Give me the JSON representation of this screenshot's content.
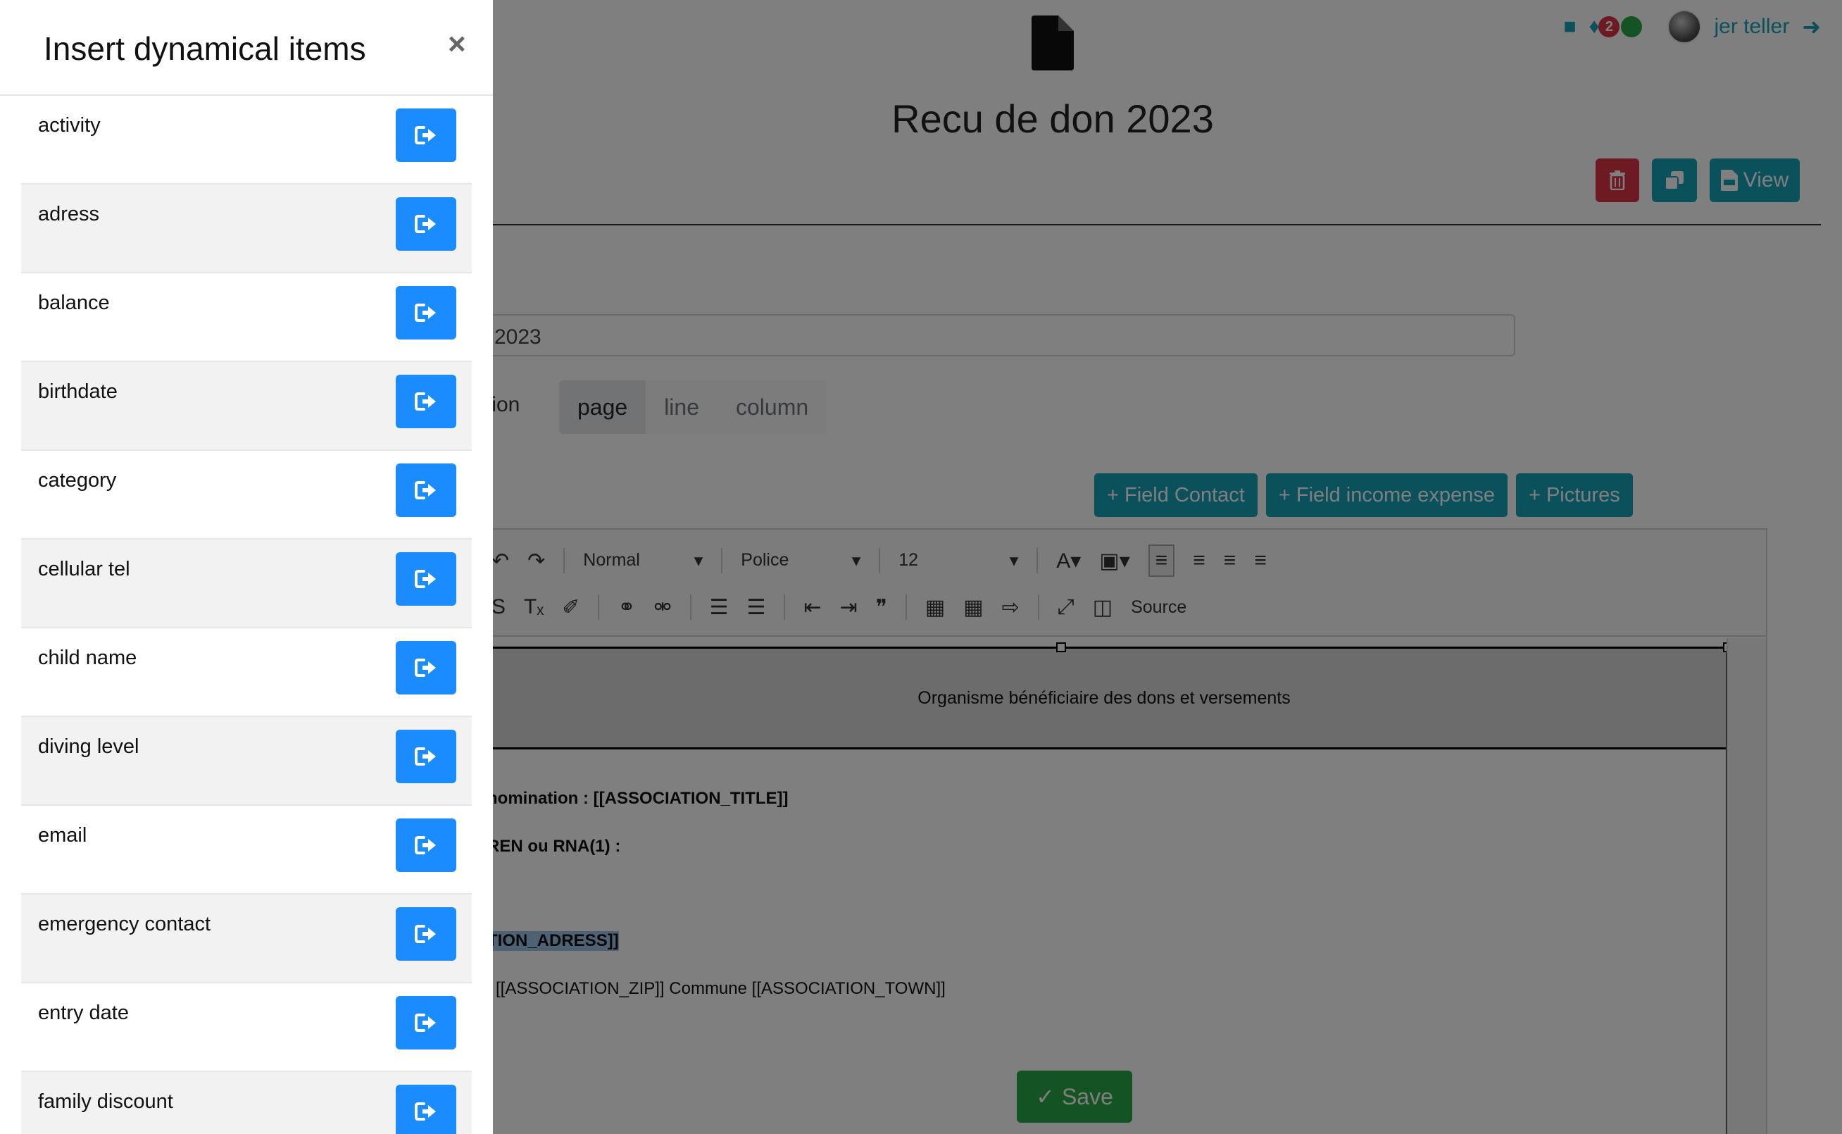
{
  "header": {
    "user_name": "jer teller",
    "notification_count": "2"
  },
  "document": {
    "title": "Recu de don 2023",
    "view_label": "View",
    "title_input_value": "2023",
    "orientation_label": "tion",
    "orientation_options": [
      "page",
      "line",
      "column"
    ],
    "orientation_selected": "page"
  },
  "field_buttons": {
    "contact": "+ Field Contact",
    "income_expense": "+ Field income expense",
    "pictures": "+ Pictures"
  },
  "editor": {
    "format_select": "Normal",
    "font_select": "Police",
    "size_select": "12",
    "source_label": "Source",
    "content": {
      "header_text": "Organisme bénéficiaire des dons et versements",
      "line1": "nomination :  [[ASSOCIATION_TITLE]]",
      "line2": "REN ou RNA(1) :",
      "line3": "TION_ADRESS]]",
      "line4": "[[ASSOCIATION_ZIP]] Commune [[ASSOCIATION_TOWN]]"
    }
  },
  "save_label": "Save",
  "panel": {
    "title": "Insert dynamical items",
    "close_symbol": "×",
    "items": [
      {
        "label": "activity"
      },
      {
        "label": "adress"
      },
      {
        "label": "balance"
      },
      {
        "label": "birthdate"
      },
      {
        "label": "category"
      },
      {
        "label": "cellular tel"
      },
      {
        "label": "child name"
      },
      {
        "label": "diving level"
      },
      {
        "label": "email"
      },
      {
        "label": "emergency contact"
      },
      {
        "label": "entry date"
      },
      {
        "label": "family discount"
      }
    ]
  },
  "colors": {
    "insert_button": "#1a8cff",
    "teal": "#17a2b8",
    "danger": "#dc3545",
    "success": "#28a745"
  },
  "icons": {
    "insert": "sign-in-icon",
    "document": "file-icon",
    "delete": "trash-icon",
    "duplicate": "copy-icon",
    "pdf": "pdf-icon",
    "save": "check-icon"
  }
}
